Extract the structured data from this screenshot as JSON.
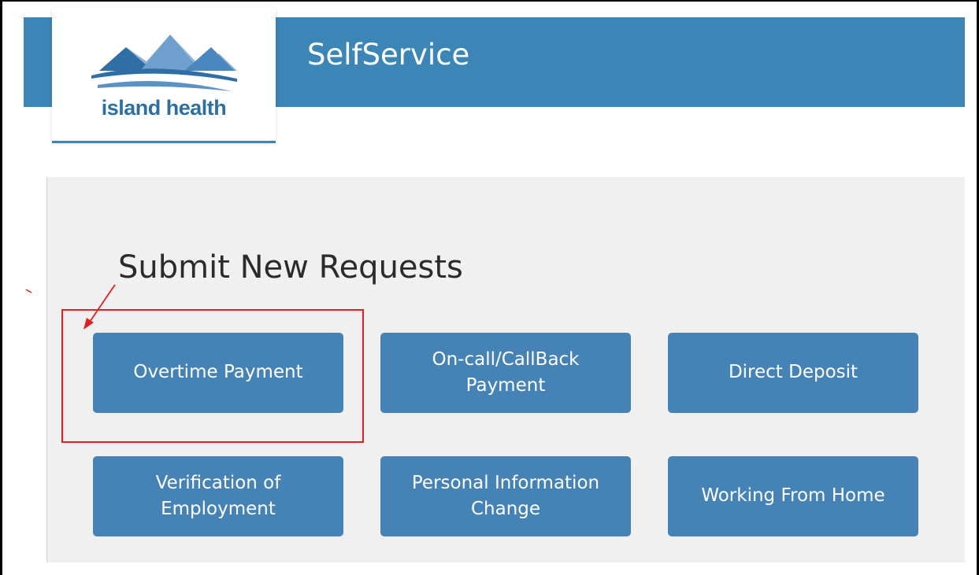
{
  "header": {
    "app_title": "SelfService",
    "logo_text": "island health",
    "accent_color": "#3b85b7"
  },
  "main": {
    "heading": "Submit New Requests",
    "buttons": [
      {
        "label": "Overtime Payment"
      },
      {
        "label": "On-call/CallBack Payment"
      },
      {
        "label": "Direct Deposit"
      },
      {
        "label": "Verification of Employment"
      },
      {
        "label": "Personal Information Change"
      },
      {
        "label": "Working From Home"
      }
    ],
    "button_color": "#4583b6"
  },
  "annotation": {
    "color": "#e21e1e"
  }
}
